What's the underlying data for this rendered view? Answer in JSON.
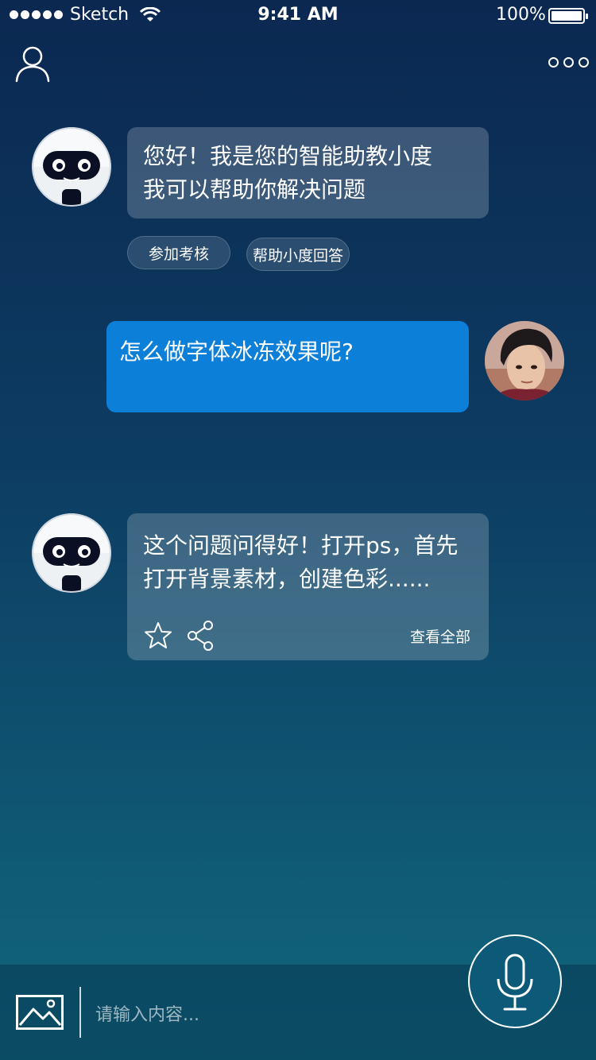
{
  "status_bar": {
    "carrier": "Sketch",
    "time": "9:41 AM",
    "battery": "100%"
  },
  "nav": {
    "profile_icon": "user-icon",
    "more_icon": "more-icon"
  },
  "messages": [
    {
      "sender": "bot",
      "text": "您好！我是您的智能助教小度\n我可以帮助你解决问题",
      "quick_replies": [
        "参加考核",
        "帮助小度回答"
      ]
    },
    {
      "sender": "user",
      "text": "怎么做字体冰冻效果呢?"
    },
    {
      "sender": "bot",
      "text": "这个问题问得好！打开ps，首先\n打开背景素材，创建色彩......",
      "actions": [
        "star-icon",
        "share-icon"
      ],
      "view_all": "查看全部"
    }
  ],
  "input_bar": {
    "placeholder": "请输入内容...",
    "image_icon": "image-icon",
    "mic_icon": "microphone-icon"
  },
  "colors": {
    "background_top": "#0b2851",
    "background_bottom": "#11677e",
    "user_bubble": "#0c7fd9"
  }
}
